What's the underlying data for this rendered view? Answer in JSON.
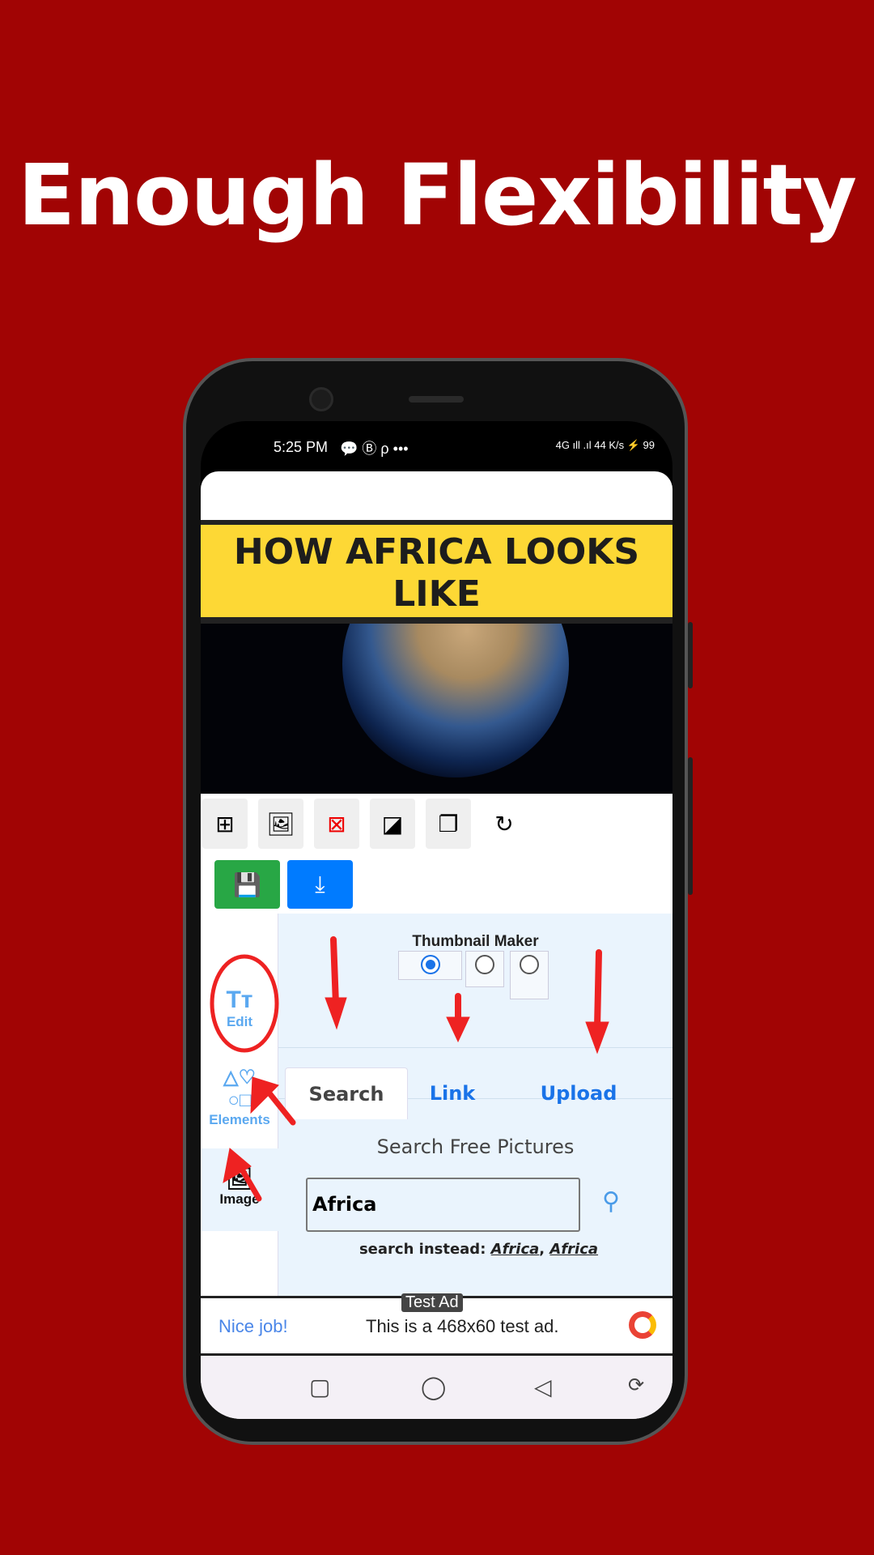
{
  "headline": "Enough Flexibility",
  "status": {
    "time": "5:25 PM",
    "icons": [
      "chat-icon",
      "b-icon",
      "p-icon",
      "more-dots-icon"
    ],
    "right": "4G ıll .ıl 44 K/s ⚡ 99"
  },
  "canvas": {
    "banner_text": "HOW AFRICA LOOKS LIKE",
    "background": "earth-from-space"
  },
  "toolbar": {
    "buttons": [
      "add-page-icon",
      "image-frame-icon",
      "delete-icon",
      "bring-front-icon",
      "duplicate-icon",
      "rotate-icon"
    ],
    "save": "save-icon",
    "download": "download-icon"
  },
  "sidebar": {
    "items": [
      {
        "label": "Edit",
        "icon": "text-size-icon"
      },
      {
        "label": "Elements",
        "icon": "shapes-icon"
      },
      {
        "label": "Image",
        "icon": "image-icon"
      }
    ]
  },
  "panel": {
    "title": "Thumbnail Maker",
    "tabs": [
      "Search",
      "Link",
      "Upload"
    ],
    "heading": "Search Free Pictures",
    "search_value": "Africa",
    "instead_label": "search instead:",
    "instead_links": [
      "Africa",
      "Africa"
    ]
  },
  "ad": {
    "badge": "Test Ad",
    "left": "Nice job!",
    "text": "This is a 468x60 test ad."
  },
  "colors": {
    "background": "#a10404",
    "banner": "#fdd835",
    "save": "#28a745",
    "download": "#007bff",
    "link": "#1a73e8",
    "annotation": "#ee2222"
  }
}
